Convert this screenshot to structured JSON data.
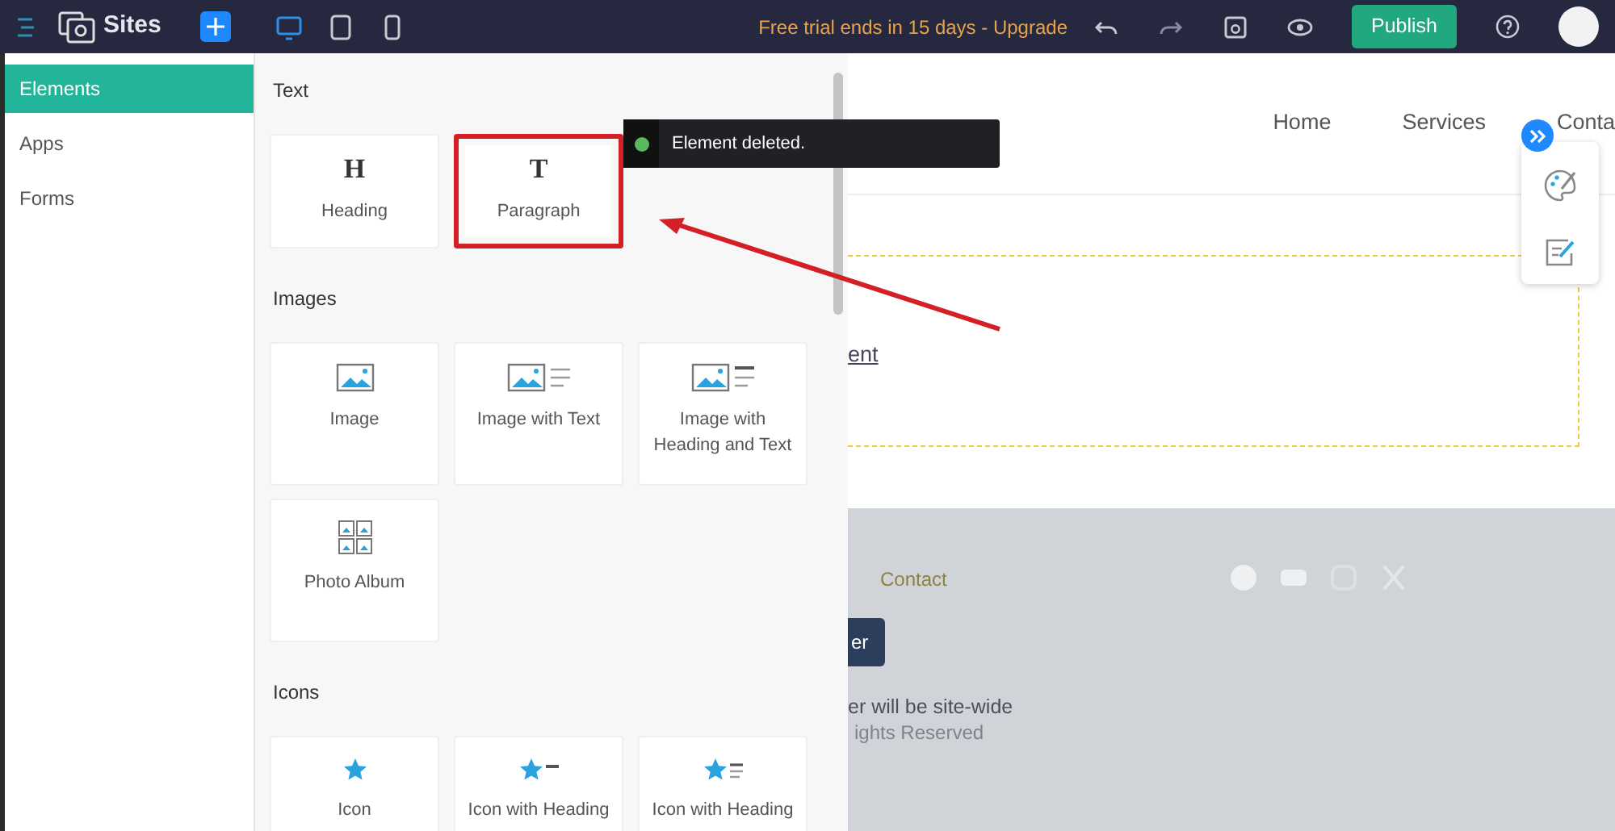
{
  "topbar": {
    "app_title": "Sites",
    "devices": [
      {
        "kind": "desktop",
        "selected": true
      },
      {
        "kind": "tablet",
        "selected": false
      },
      {
        "kind": "mobile",
        "selected": false
      }
    ],
    "trial_text": "Free trial ends in 15 days - Upgrade",
    "publish_label": "Publish"
  },
  "sidebar": {
    "items": [
      {
        "label": "Elements",
        "selected": true
      },
      {
        "label": "Apps",
        "selected": false
      },
      {
        "label": "Forms",
        "selected": false
      }
    ]
  },
  "panel": {
    "sections": [
      {
        "title": "Text",
        "items": [
          {
            "label": "Heading",
            "kind": "heading",
            "glyph": "H",
            "highlighted": false
          },
          {
            "label": "Paragraph",
            "kind": "paragraph",
            "glyph": "T",
            "highlighted": true
          }
        ]
      },
      {
        "title": "Images",
        "items": [
          {
            "label": "Image",
            "kind": "image",
            "highlighted": false
          },
          {
            "label": "Image with Text",
            "kind": "image-text",
            "highlighted": false
          },
          {
            "label": "Image with Heading and Text",
            "kind": "image-heading-text",
            "highlighted": false
          },
          {
            "label": "Photo Album",
            "kind": "album",
            "highlighted": false
          }
        ]
      },
      {
        "title": "Icons",
        "items": [
          {
            "label": "Icon",
            "kind": "star",
            "highlighted": false
          },
          {
            "label": "Icon with Heading",
            "kind": "star-line",
            "highlighted": false
          },
          {
            "label": "Icon with Heading",
            "kind": "star-lines",
            "highlighted": false
          }
        ]
      }
    ]
  },
  "toast": {
    "text": "Element deleted."
  },
  "canvas": {
    "nav_links": [
      "Home",
      "Services",
      "Conta"
    ],
    "link_text": "ent",
    "footer": {
      "contact": "Contact",
      "button": "er",
      "note": "er will be site-wide",
      "rights": "ights Reserved"
    }
  }
}
